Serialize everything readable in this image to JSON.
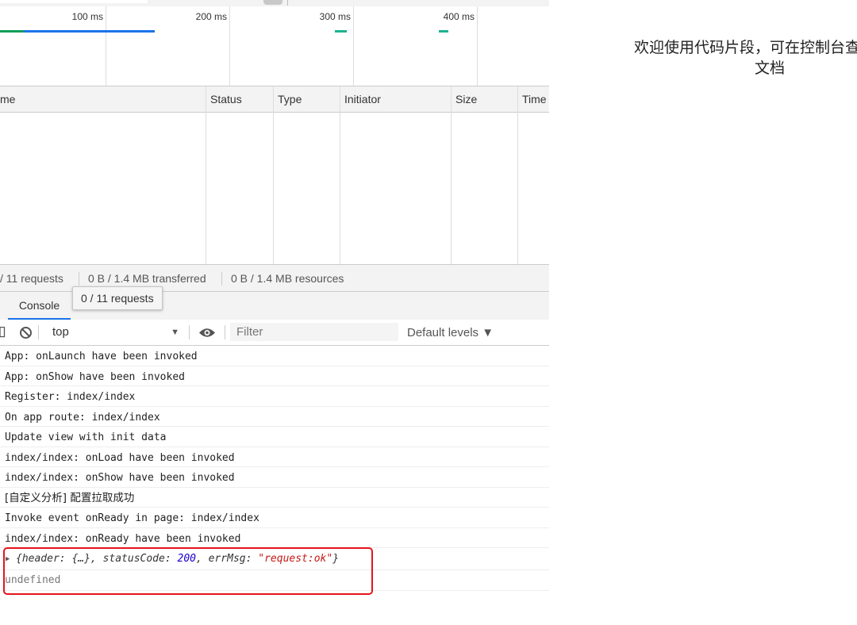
{
  "timeline": {
    "ticks": [
      "100 ms",
      "200 ms",
      "300 ms",
      "400 ms"
    ],
    "colors": {
      "download": "#1a73e8",
      "waiting": "#0f9d58",
      "teal": "#1db28f"
    }
  },
  "network": {
    "columns": [
      "me",
      "Status",
      "Type",
      "Initiator",
      "Size",
      "Time"
    ]
  },
  "summary": {
    "requests": "/ 11 requests",
    "transferred": "0 B / 1.4 MB transferred",
    "resources": "0 B / 1.4 MB resources"
  },
  "drawer": {
    "tab_console": "Console",
    "tooltip": "0 / 11 requests"
  },
  "console_toolbar": {
    "context": "top",
    "filter_placeholder": "Filter",
    "levels": "Default levels ▼"
  },
  "console": {
    "messages": [
      "App: onLaunch have been invoked",
      "App: onShow have been invoked",
      "Register: index/index",
      "On app route: index/index",
      "Update view with init data",
      "index/index: onLoad have been invoked",
      "index/index: onShow have been invoked",
      "[自定义分析] 配置拉取成功",
      "Invoke event onReady in page: index/index",
      "index/index: onReady have been invoked"
    ],
    "object": {
      "open": "{header: {…}, statusCode: ",
      "status": "200",
      "mid": ", errMsg: ",
      "errmsg": "\"request:ok\"",
      "close": "}"
    },
    "undefined_text": "undefined"
  },
  "simulator": {
    "welcome_line1": "欢迎使用代码片段，可在控制台查看代码",
    "welcome_line2": "文档"
  }
}
